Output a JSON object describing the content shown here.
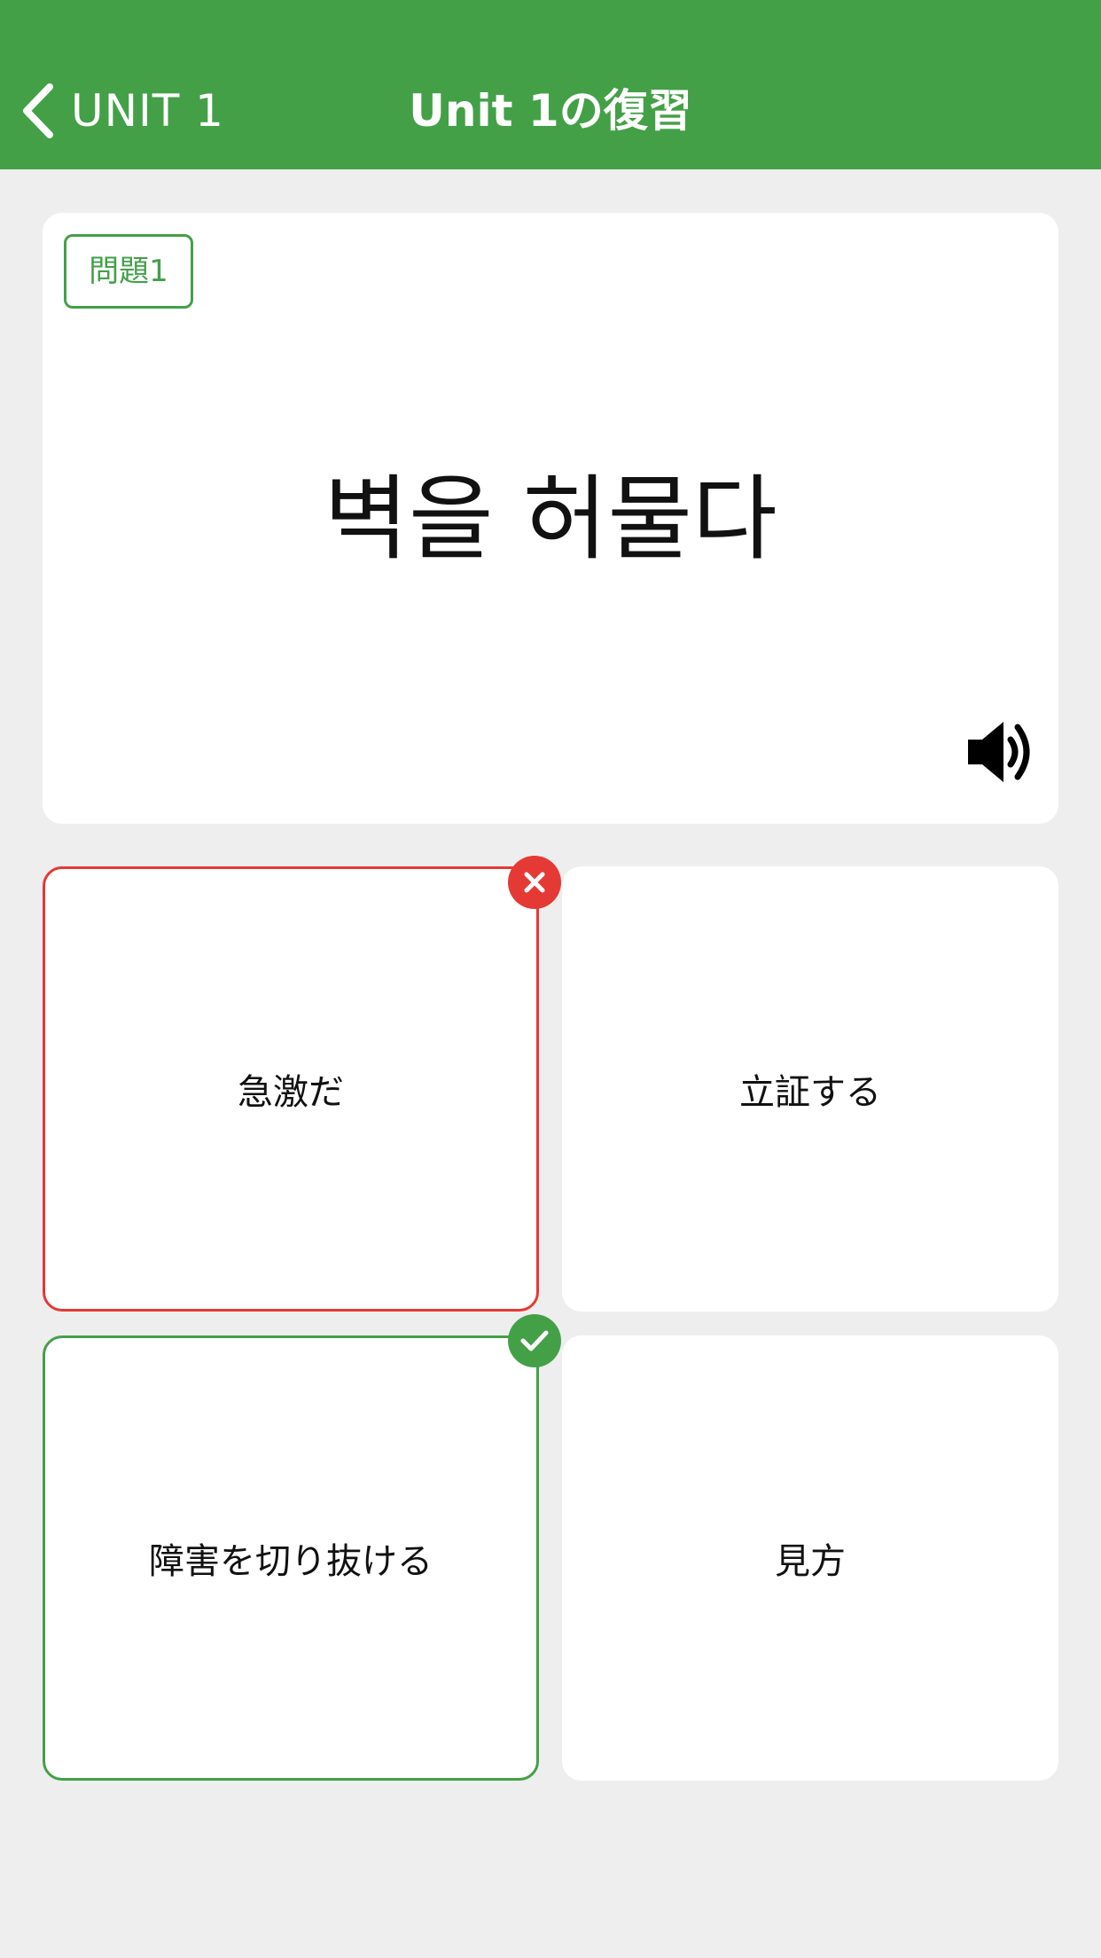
{
  "colors": {
    "accent": "#43a047",
    "wrong": "#e53935",
    "background": "#eeeeee",
    "card": "#ffffff"
  },
  "header": {
    "back_label": "UNIT 1",
    "title": "Unit 1の復習"
  },
  "question": {
    "badge": "問題1",
    "word": "벽을 허물다",
    "audio_icon": "speaker-icon"
  },
  "options": [
    {
      "label": "急激だ",
      "state": "wrong"
    },
    {
      "label": "立証する",
      "state": "none"
    },
    {
      "label": "障害を切り抜ける",
      "state": "correct"
    },
    {
      "label": "見方",
      "state": "none"
    }
  ]
}
